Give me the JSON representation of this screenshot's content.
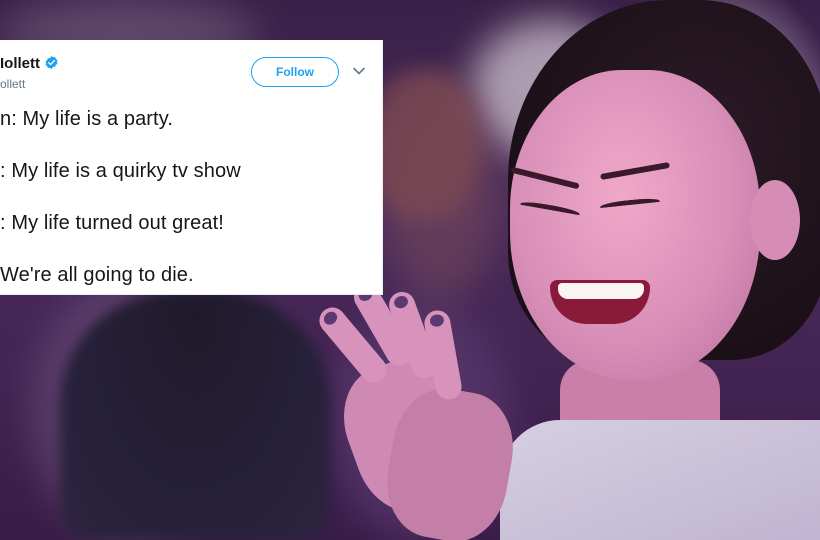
{
  "tweet": {
    "user_name": "Iollett",
    "verified": true,
    "user_handle": "ollett",
    "follow_label": "Follow",
    "lines": [
      "n: My life is a party.",
      ": My life is a quirky tv show",
      ": My life turned out great!",
      "We're all going to die."
    ]
  },
  "colors": {
    "accent": "#1da1f2",
    "text": "#14171a",
    "muted": "#657786",
    "card_bg": "#ffffff"
  },
  "icons": {
    "verified": "verified-badge-icon",
    "caret": "chevron-down-icon"
  }
}
